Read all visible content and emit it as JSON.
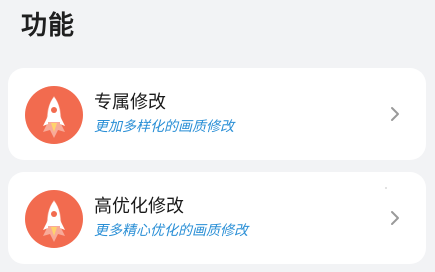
{
  "section": {
    "title": "功能"
  },
  "items": [
    {
      "title": "专属修改",
      "subtitle": "更加多样化的画质修改",
      "icon": "rocket-icon",
      "chevron": "chevron-right-icon"
    },
    {
      "title": "高优化修改",
      "subtitle": "更多精心优化的画质修改",
      "icon": "rocket-icon",
      "chevron": "chevron-right-icon"
    }
  ],
  "colors": {
    "background": "#f2f3f5",
    "card": "#ffffff",
    "icon_circle": "#f26b4f",
    "subtitle": "#2a8fd6",
    "chevron": "#9a9a9a"
  }
}
